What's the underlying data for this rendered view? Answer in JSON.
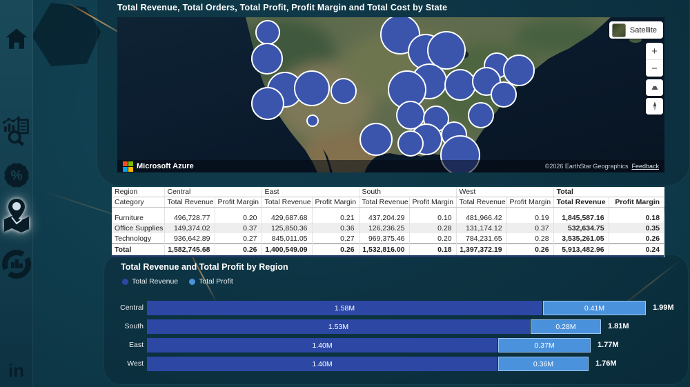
{
  "sidebar": {
    "icons": [
      "home-icon",
      "analytics-search-icon",
      "percent-badge-icon",
      "map-location-icon",
      "donut-chart-icon",
      "linkedin-icon"
    ],
    "active_icon": "map-location-icon",
    "percent_glyph": "%",
    "linkedin_glyph": "in"
  },
  "map_visual": {
    "title": "Total Revenue, Total Orders, Total Profit, Profit Margin and Total Cost by State",
    "satellite_button_label": "Satellite",
    "zoom_in_glyph": "+",
    "zoom_out_glyph": "−",
    "attribution_left": "Microsoft Azure",
    "attribution_right": "©2026 EarthStar Geographics",
    "feedback_link": "Feedback",
    "bubble_color": "#3a55ab",
    "bubbles": [
      [
        218,
        22,
        17
      ],
      [
        217,
        60,
        22
      ],
      [
        243,
        105,
        25
      ],
      [
        218,
        125,
        23
      ],
      [
        282,
        103,
        25
      ],
      [
        328,
        107,
        18
      ],
      [
        283,
        150,
        8
      ],
      [
        375,
        177,
        23
      ],
      [
        410,
        25,
        28
      ],
      [
        447,
        50,
        25
      ],
      [
        477,
        48,
        27
      ],
      [
        452,
        93,
        25
      ],
      [
        420,
        105,
        27
      ],
      [
        497,
        98,
        22
      ],
      [
        550,
        70,
        18
      ],
      [
        582,
        77,
        22
      ],
      [
        535,
        93,
        20
      ],
      [
        560,
        112,
        18
      ],
      [
        425,
        142,
        20
      ],
      [
        462,
        147,
        18
      ],
      [
        527,
        142,
        18
      ],
      [
        448,
        177,
        22
      ],
      [
        488,
        170,
        18
      ],
      [
        425,
        183,
        18
      ],
      [
        497,
        200,
        28
      ]
    ]
  },
  "table": {
    "region_header_label": "Region",
    "category_header_label": "Category",
    "regions": [
      "Central",
      "East",
      "South",
      "West",
      "Total"
    ],
    "measure_headers": [
      "Total Revenue",
      "Profit Margin"
    ],
    "rows": [
      {
        "category": "Furniture",
        "values": [
          "496,728.77",
          "0.20",
          "429,687.68",
          "0.21",
          "437,204.29",
          "0.10",
          "481,966.42",
          "0.19",
          "1,845,587.16",
          "0.18"
        ]
      },
      {
        "category": "Office Supplies",
        "values": [
          "149,374.02",
          "0.37",
          "125,850.36",
          "0.36",
          "126,236.25",
          "0.28",
          "131,174.12",
          "0.37",
          "532,634.75",
          "0.35"
        ]
      },
      {
        "category": "Technology",
        "values": [
          "936,642.89",
          "0.27",
          "845,011.05",
          "0.27",
          "969,375.46",
          "0.20",
          "784,231.65",
          "0.28",
          "3,535,261.05",
          "0.26"
        ]
      },
      {
        "category": "Total",
        "values": [
          "1,582,745.68",
          "0.26",
          "1,400,549.09",
          "0.26",
          "1,532,816.00",
          "0.18",
          "1,397,372.19",
          "0.26",
          "5,913,482.96",
          "0.24"
        ]
      }
    ]
  },
  "bar_chart": {
    "title": "Total Revenue and Total Profit by Region",
    "colors": {
      "revenue": "#2c48a4",
      "profit": "#4b92dd"
    },
    "chart_data": {
      "type": "bar",
      "orientation": "horizontal",
      "categories": [
        "Central",
        "South",
        "East",
        "West"
      ],
      "series": [
        {
          "name": "Total Revenue",
          "values_m": [
            1.58,
            1.53,
            1.4,
            1.4
          ],
          "labels": [
            "1.58M",
            "1.53M",
            "1.40M",
            "1.40M"
          ]
        },
        {
          "name": "Total Profit",
          "values_m": [
            0.41,
            0.28,
            0.37,
            0.36
          ],
          "labels": [
            "0.41M",
            "0.28M",
            "0.37M",
            "0.36M"
          ]
        }
      ],
      "totals": [
        "1.99M",
        "1.81M",
        "1.77M",
        "1.76M"
      ],
      "legend_position": "top"
    }
  }
}
